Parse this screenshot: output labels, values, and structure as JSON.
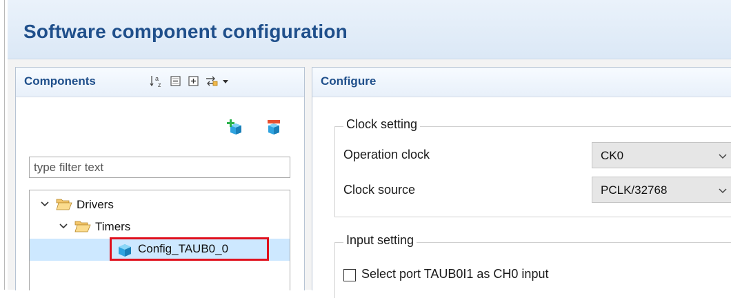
{
  "page": {
    "title": "Software component configuration"
  },
  "components_panel": {
    "title": "Components",
    "toolbar_icons": [
      "sort-alpha-icon",
      "collapse-all-icon",
      "expand-all-icon",
      "link-editor-icon",
      "chevron-down-icon"
    ],
    "actions": [
      "add-component-icon",
      "remove-component-icon"
    ],
    "filter": {
      "placeholder": "type filter text",
      "value": ""
    },
    "tree": {
      "drivers": {
        "label": "Drivers",
        "expanded": true
      },
      "timers": {
        "label": "Timers",
        "expanded": true
      },
      "config": {
        "label": "Config_TAUB0_0",
        "selected": true
      }
    }
  },
  "configure_panel": {
    "title": "Configure",
    "clock_setting": {
      "legend": "Clock setting",
      "operation_clock": {
        "label": "Operation clock",
        "value": "CK0"
      },
      "clock_source": {
        "label": "Clock source",
        "value": "PCLK/32768"
      }
    },
    "input_setting": {
      "legend": "Input setting",
      "select_port": {
        "label": "Select port TAUB0I1 as CH0 input",
        "checked": false
      }
    }
  },
  "colors": {
    "title": "#1f4f8b",
    "selection": "#cde8ff",
    "highlight_border": "#e0101d"
  }
}
